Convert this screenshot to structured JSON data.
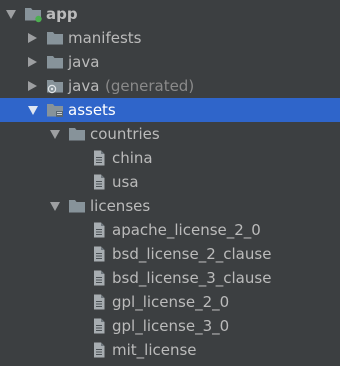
{
  "tree": {
    "rows": [
      {
        "label": "app",
        "bold": true,
        "depth": 0,
        "arrow": "down",
        "icon": "module-folder-icon"
      },
      {
        "label": "manifests",
        "depth": 1,
        "arrow": "right",
        "icon": "folder-icon"
      },
      {
        "label": "java",
        "depth": 1,
        "arrow": "right",
        "icon": "folder-icon"
      },
      {
        "label": "java",
        "suffix": "(generated)",
        "depth": 1,
        "arrow": "right",
        "icon": "generated-folder-icon"
      },
      {
        "label": "assets",
        "depth": 1,
        "arrow": "down",
        "icon": "assets-folder-icon",
        "selected": true
      },
      {
        "label": "countries",
        "depth": 2,
        "arrow": "down",
        "icon": "folder-icon"
      },
      {
        "label": "china",
        "depth": 3,
        "icon": "file-icon"
      },
      {
        "label": "usa",
        "depth": 3,
        "icon": "file-icon"
      },
      {
        "label": "licenses",
        "depth": 2,
        "arrow": "down",
        "icon": "folder-icon"
      },
      {
        "label": "apache_license_2_0",
        "depth": 3,
        "icon": "file-icon"
      },
      {
        "label": "bsd_license_2_clause",
        "depth": 3,
        "icon": "file-icon"
      },
      {
        "label": "bsd_license_3_clause",
        "depth": 3,
        "icon": "file-icon"
      },
      {
        "label": "gpl_license_2_0",
        "depth": 3,
        "icon": "file-icon"
      },
      {
        "label": "gpl_license_3_0",
        "depth": 3,
        "icon": "file-icon"
      },
      {
        "label": "mit_license",
        "depth": 3,
        "icon": "file-icon"
      }
    ]
  },
  "colors": {
    "background": "#3c3f41",
    "selection": "#2f65ca",
    "folder": "#87939a",
    "text": "#bbbbbb",
    "module_dot": "#4caf50"
  }
}
